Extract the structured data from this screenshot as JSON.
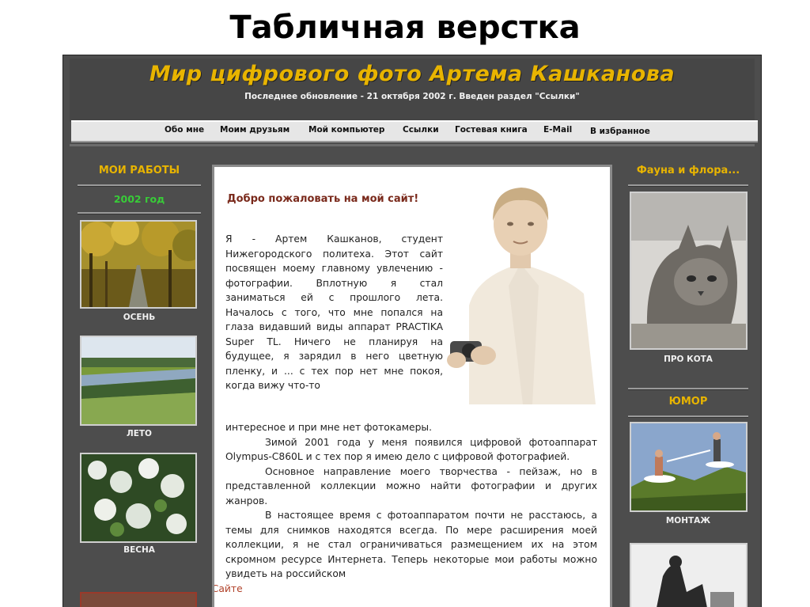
{
  "slide": {
    "title": "Табличная верстка"
  },
  "site": {
    "title": "Мир цифрового фото Артема Кашканова",
    "subtitle": "Последнее обновление - 21 октября 2002 г. Введен раздел \"Ссылки\""
  },
  "nav": {
    "items": [
      "Обо мне",
      "Моим друзьям",
      "Мой компьютер",
      "Ссылки",
      "Гостевая книга",
      "E-Mail",
      "В избранное"
    ]
  },
  "left": {
    "heading": "МОИ РАБОТЫ",
    "year": "2002 год",
    "thumbs": [
      {
        "caption": "ОСЕНЬ"
      },
      {
        "caption": "ЛЕТО"
      },
      {
        "caption": "ВЕСНА"
      }
    ]
  },
  "right": {
    "heading1": "Фауна и флора...",
    "thumb1_caption": "ПРО КОТА",
    "heading2": "ЮМОР",
    "thumb2_caption": "МОНТАЖ"
  },
  "main": {
    "welcome": "Добро пожаловать на мой сайт!",
    "para1": "Я - Артем Кашканов, студент Нижегородского политеха. Этот сайт посвящен моему главному увлечению - фотографии. Вплотную я стал заниматься ей с прошлого лета. Началось с того, что мне попался на глаза видавший виды аппарат PRACTIKA Super TL. Ничего не планируя на будущее, я зарядил в него цветную пленку, и ... с тех пор нет мне покоя, когда вижу что-то",
    "para1_end": "интересное и при мне нет фотокамеры.",
    "para2": "Зимой 2001 года у меня появился цифровой фотоаппарат Olympus-C860L и с тех пор я имею дело с цифровой фотографией.",
    "para3": "Основное направление моего творчества - пейзаж, но в представленной коллекции можно найти фотографии и других жанров.",
    "para4": "В настоящее время с фотоаппаратом почти не расстаюсь, а темы для снимков находятся всегда. По мере расширения моей коллекции, я не стал ограничиваться размещением их на этом скромном ресурсе Интернета. Теперь некоторые мои работы можно увидеть на российском",
    "fotosite": "ФотоСайте"
  }
}
